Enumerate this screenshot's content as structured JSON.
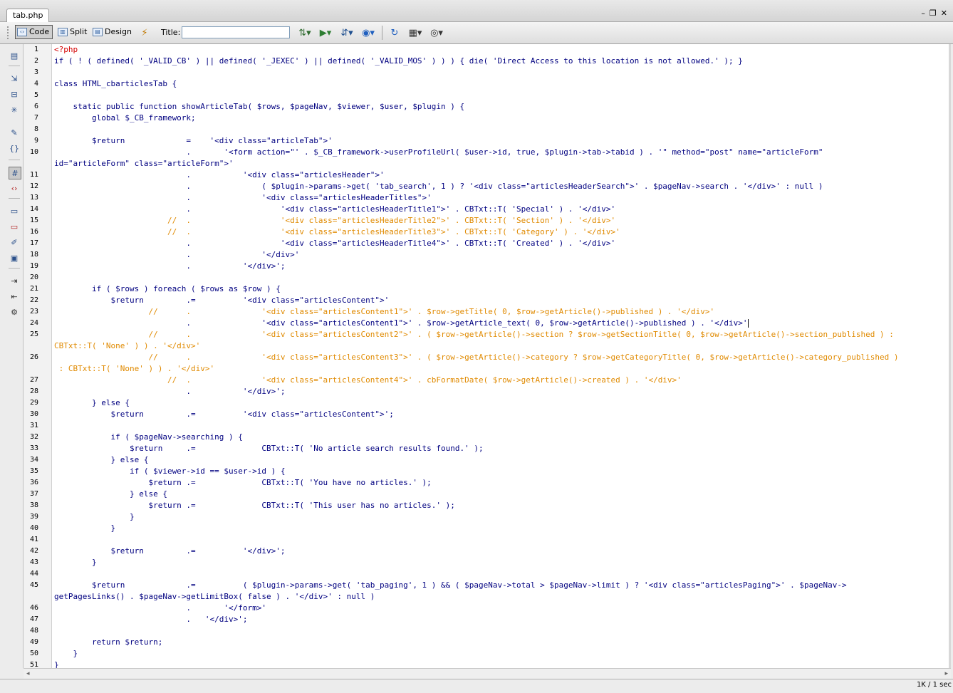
{
  "document": {
    "tab_name": "tab.php",
    "window_controls": {
      "minimize": "–",
      "restore": "❐",
      "close": "✕"
    }
  },
  "toolbar": {
    "view_buttons": [
      "Code",
      "Split",
      "Design"
    ],
    "active_view": "Code",
    "title_label": "Title:",
    "title_value": "",
    "icons": [
      "live-view-icon",
      "file-management-icon",
      "validate-icon",
      "browser-preview-icon",
      "refresh-icon",
      "view-options-icon",
      "visual-aids-icon"
    ]
  },
  "left_toolbar": {
    "icons": [
      "open-documents-icon",
      "collapse-full-tag-icon",
      "collapse-selection-icon",
      "expand-all-icon",
      "select-parent-tag-icon",
      "balance-braces-icon",
      "line-numbers-icon",
      "highlight-invalid-code-icon",
      "apply-comment-icon",
      "remove-comment-icon",
      "wrap-tag-icon",
      "recent-snippets-icon",
      "indent-code-icon",
      "outdent-code-icon",
      "format-source-icon"
    ]
  },
  "editor": {
    "lines": [
      {
        "n": "1",
        "text": "<?php",
        "style": "php-open"
      },
      {
        "n": "2",
        "text": "if ( ! ( defined( '_VALID_CB' ) || defined( '_JEXEC' ) || defined( '_VALID_MOS' ) ) ) { die( 'Direct Access to this location is not allowed.' ); }",
        "style": "code"
      },
      {
        "n": "3",
        "text": "",
        "style": "code"
      },
      {
        "n": "4",
        "text": "class HTML_cbarticlesTab {",
        "style": "code"
      },
      {
        "n": "5",
        "text": "",
        "style": "code"
      },
      {
        "n": "6",
        "text": "    static public function showArticleTab( $rows, $pageNav, $viewer, $user, $plugin ) {",
        "style": "code"
      },
      {
        "n": "7",
        "text": "        global $_CB_framework;",
        "style": "code"
      },
      {
        "n": "8",
        "text": "",
        "style": "code"
      },
      {
        "n": "9",
        "text": "        $return             =    '<div class=\"articleTab\">'",
        "style": "code"
      },
      {
        "n": "10",
        "text": "                            .       '<form action=\"' . $_CB_framework->userProfileUrl( $user->id, true, $plugin->tab->tabid ) . '\" method=\"post\" name=\"articleForm\"",
        "style": "code"
      },
      {
        "n": "",
        "text": "id=\"articleForm\" class=\"articleForm\">'",
        "style": "code"
      },
      {
        "n": "11",
        "text": "                            .           '<div class=\"articlesHeader\">'",
        "style": "code"
      },
      {
        "n": "12",
        "text": "                            .               ( $plugin->params->get( 'tab_search', 1 ) ? '<div class=\"articlesHeaderSearch\">' . $pageNav->search . '</div>' : null )",
        "style": "code"
      },
      {
        "n": "13",
        "text": "                            .               '<div class=\"articlesHeaderTitles\">'",
        "style": "code"
      },
      {
        "n": "14",
        "text": "                            .                   '<div class=\"articlesHeaderTitle1\">' . CBTxt::T( 'Special' ) . '</div>'",
        "style": "code"
      },
      {
        "n": "15",
        "text": "                        //  .                   '<div class=\"articlesHeaderTitle2\">' . CBTxt::T( 'Section' ) . '</div>'",
        "style": "comment"
      },
      {
        "n": "16",
        "text": "                        //  .                   '<div class=\"articlesHeaderTitle3\">' . CBTxt::T( 'Category' ) . '</div>'",
        "style": "comment"
      },
      {
        "n": "17",
        "text": "                            .                   '<div class=\"articlesHeaderTitle4\">' . CBTxt::T( 'Created' ) . '</div>'",
        "style": "code"
      },
      {
        "n": "18",
        "text": "                            .               '</div>'",
        "style": "code"
      },
      {
        "n": "19",
        "text": "                            .           '</div>';",
        "style": "code"
      },
      {
        "n": "20",
        "text": "",
        "style": "code"
      },
      {
        "n": "21",
        "text": "        if ( $rows ) foreach ( $rows as $row ) {",
        "style": "code"
      },
      {
        "n": "22",
        "text": "            $return         .=          '<div class=\"articlesContent\">'",
        "style": "code"
      },
      {
        "n": "23",
        "text": "                    //      .               '<div class=\"articlesContent1\">' . $row->getTitle( 0, $row->getArticle()->published ) . '</div>'",
        "style": "comment"
      },
      {
        "n": "24",
        "text": "                            .               '<div class=\"articlesContent1\">' . $row->getArticle_text( 0, $row->getArticle()->published ) . '</div>'",
        "style": "code",
        "caret": true
      },
      {
        "n": "25",
        "text": "                    //      .               '<div class=\"articlesContent2\">' . ( $row->getArticle()->section ? $row->getSectionTitle( 0, $row->getArticle()->section_published ) :",
        "style": "comment"
      },
      {
        "n": "",
        "text": "CBTxt::T( 'None' ) ) . '</div>'",
        "style": "comment"
      },
      {
        "n": "26",
        "text": "                    //      .               '<div class=\"articlesContent3\">' . ( $row->getArticle()->category ? $row->getCategoryTitle( 0, $row->getArticle()->category_published )",
        "style": "comment"
      },
      {
        "n": "",
        "text": " : CBTxt::T( 'None' ) ) . '</div>'",
        "style": "comment"
      },
      {
        "n": "27",
        "text": "                        //  .               '<div class=\"articlesContent4\">' . cbFormatDate( $row->getArticle()->created ) . '</div>'",
        "style": "comment"
      },
      {
        "n": "28",
        "text": "                            .           '</div>';",
        "style": "code"
      },
      {
        "n": "29",
        "text": "        } else {",
        "style": "code"
      },
      {
        "n": "30",
        "text": "            $return         .=          '<div class=\"articlesContent\">';",
        "style": "code"
      },
      {
        "n": "31",
        "text": "",
        "style": "code"
      },
      {
        "n": "32",
        "text": "            if ( $pageNav->searching ) {",
        "style": "code"
      },
      {
        "n": "33",
        "text": "                $return     .=              CBTxt::T( 'No article search results found.' );",
        "style": "code"
      },
      {
        "n": "34",
        "text": "            } else {",
        "style": "code"
      },
      {
        "n": "35",
        "text": "                if ( $viewer->id == $user->id ) {",
        "style": "code"
      },
      {
        "n": "36",
        "text": "                    $return .=              CBTxt::T( 'You have no articles.' );",
        "style": "code"
      },
      {
        "n": "37",
        "text": "                } else {",
        "style": "code"
      },
      {
        "n": "38",
        "text": "                    $return .=              CBTxt::T( 'This user has no articles.' );",
        "style": "code"
      },
      {
        "n": "39",
        "text": "                }",
        "style": "code"
      },
      {
        "n": "40",
        "text": "            }",
        "style": "code"
      },
      {
        "n": "41",
        "text": "",
        "style": "code"
      },
      {
        "n": "42",
        "text": "            $return         .=          '</div>';",
        "style": "code"
      },
      {
        "n": "43",
        "text": "        }",
        "style": "code"
      },
      {
        "n": "44",
        "text": "",
        "style": "code"
      },
      {
        "n": "45",
        "text": "        $return             .=          ( $plugin->params->get( 'tab_paging', 1 ) && ( $pageNav->total > $pageNav->limit ) ? '<div class=\"articlesPaging\">' . $pageNav->",
        "style": "code"
      },
      {
        "n": "",
        "text": "getPagesLinks() . $pageNav->getLimitBox( false ) . '</div>' : null )",
        "style": "code"
      },
      {
        "n": "46",
        "text": "                            .       '</form>'",
        "style": "code"
      },
      {
        "n": "47",
        "text": "                            .   '</div>';",
        "style": "code"
      },
      {
        "n": "48",
        "text": "",
        "style": "code"
      },
      {
        "n": "49",
        "text": "        return $return;",
        "style": "code"
      },
      {
        "n": "50",
        "text": "    }",
        "style": "code"
      },
      {
        "n": "51",
        "text": "}",
        "style": "code"
      }
    ]
  },
  "status": {
    "download_stats": "1K / 1 sec"
  },
  "colors": {
    "code_text": "#000080",
    "php_tag": "#d40000",
    "comment": "#e08a00",
    "background": "#ffffff",
    "chrome": "#ececec"
  }
}
